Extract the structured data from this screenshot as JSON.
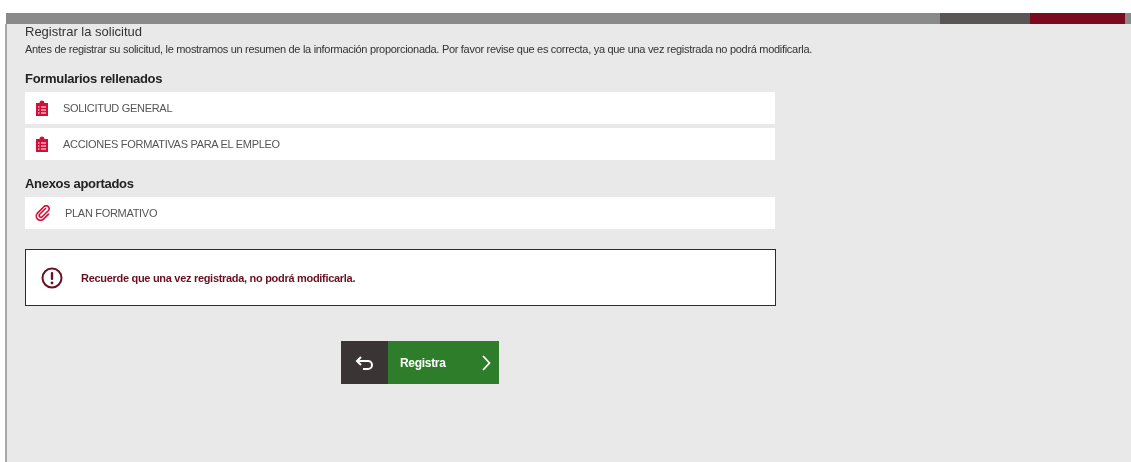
{
  "page": {
    "title": "Registrar la solicitud",
    "description": "Antes de registrar su solicitud, le mostramos un resumen de la información proporcionada. Por favor revise que es correcta, ya que una vez registrada no podrá modificarla."
  },
  "sections": [
    {
      "heading": "Formularios rellenados",
      "items": [
        {
          "label": "SOLICITUD GENERAL",
          "kind": "form"
        },
        {
          "label": "ACCIONES FORMATIVAS PARA EL EMPLEO",
          "kind": "form"
        }
      ]
    },
    {
      "heading": "Anexos aportados",
      "items": [
        {
          "label": "PLAN FORMATIVO",
          "kind": "attachment"
        }
      ]
    }
  ],
  "alert": {
    "text": "Recuerde que una vez registrada, no podrá modificarla."
  },
  "register_button": {
    "label": "Registra"
  }
}
